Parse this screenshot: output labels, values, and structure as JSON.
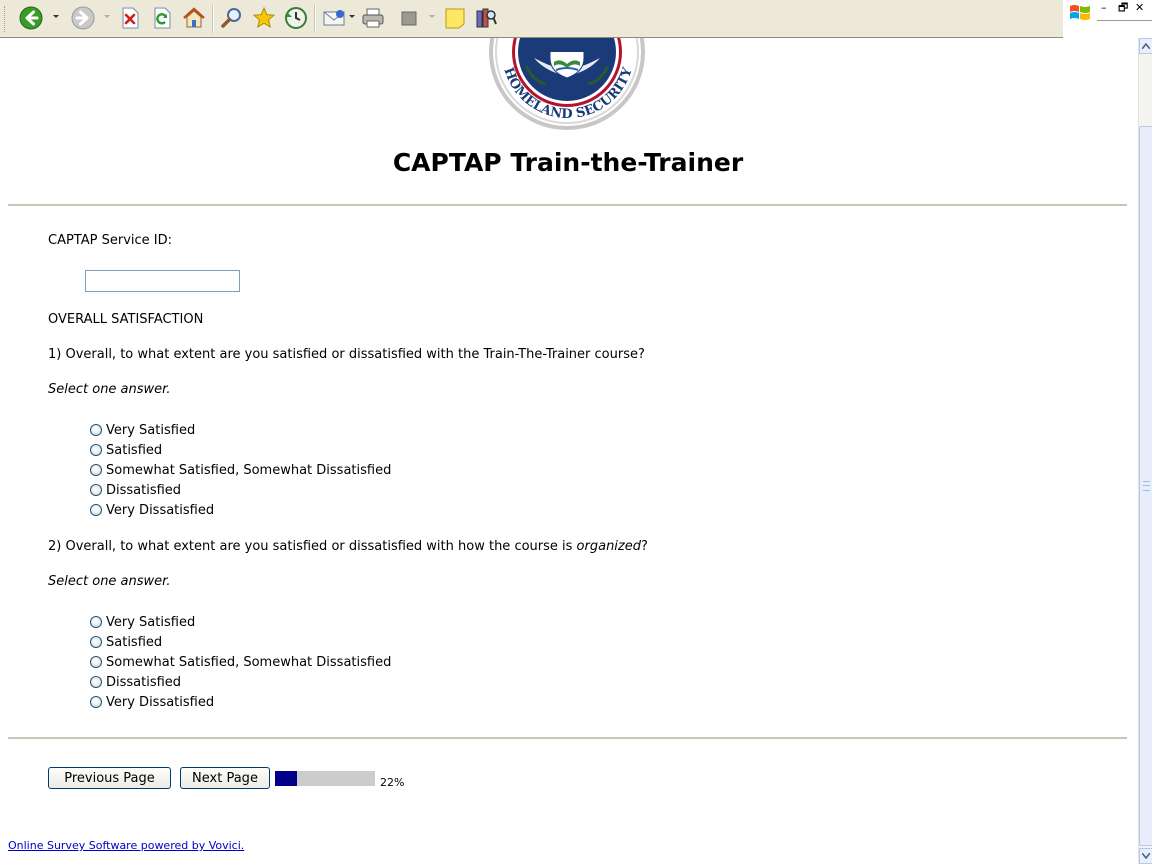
{
  "toolbar": {
    "icons": [
      "back-icon",
      "forward-icon",
      "stop-icon",
      "refresh-icon",
      "home-icon",
      "search-icon",
      "favorites-icon",
      "history-icon",
      "mail-icon",
      "print-icon",
      "edit-icon",
      "discuss-icon",
      "research-icon"
    ]
  },
  "window": {
    "minimize": "–",
    "restore": "🗗",
    "close": "✕"
  },
  "survey": {
    "title": "CAPTAP Train-the-Trainer",
    "service_id_label": "CAPTAP Service ID:",
    "service_id_value": "",
    "section_label": "OVERALL SATISFACTION",
    "questions": [
      {
        "text_pre": "1) Overall, to what extent are you satisfied or dissatisfied with the Train-The-Trainer course?",
        "text_em": "",
        "text_post": "",
        "instruction": "Select one answer.",
        "options": [
          "Very Satisfied",
          "Satisfied",
          "Somewhat Satisfied, Somewhat Dissatisfied",
          "Dissatisfied",
          "Very Dissatisfied"
        ]
      },
      {
        "text_pre": "2) Overall, to what extent are you satisfied or dissatisfied with how the course is ",
        "text_em": "organized",
        "text_post": "?",
        "instruction": "Select one answer.",
        "options": [
          "Very Satisfied",
          "Satisfied",
          "Somewhat Satisfied, Somewhat Dissatisfied",
          "Dissatisfied",
          "Very Dissatisfied"
        ]
      }
    ]
  },
  "nav": {
    "previous_label": "Previous Page",
    "next_label": "Next Page",
    "progress_percent": 22,
    "progress_text": "22%"
  },
  "seal": {
    "text": "HOMELAND SECURITY"
  },
  "footer": {
    "link_text": "Online Survey Software powered by Vovici."
  },
  "colors": {
    "toolbar_bg": "#ECE9D8",
    "progress_fill": "#000088",
    "progress_track": "#CCCCCC",
    "link": "#0000CC",
    "seal_blue": "#1a3a78",
    "seal_red": "#b3132b"
  }
}
